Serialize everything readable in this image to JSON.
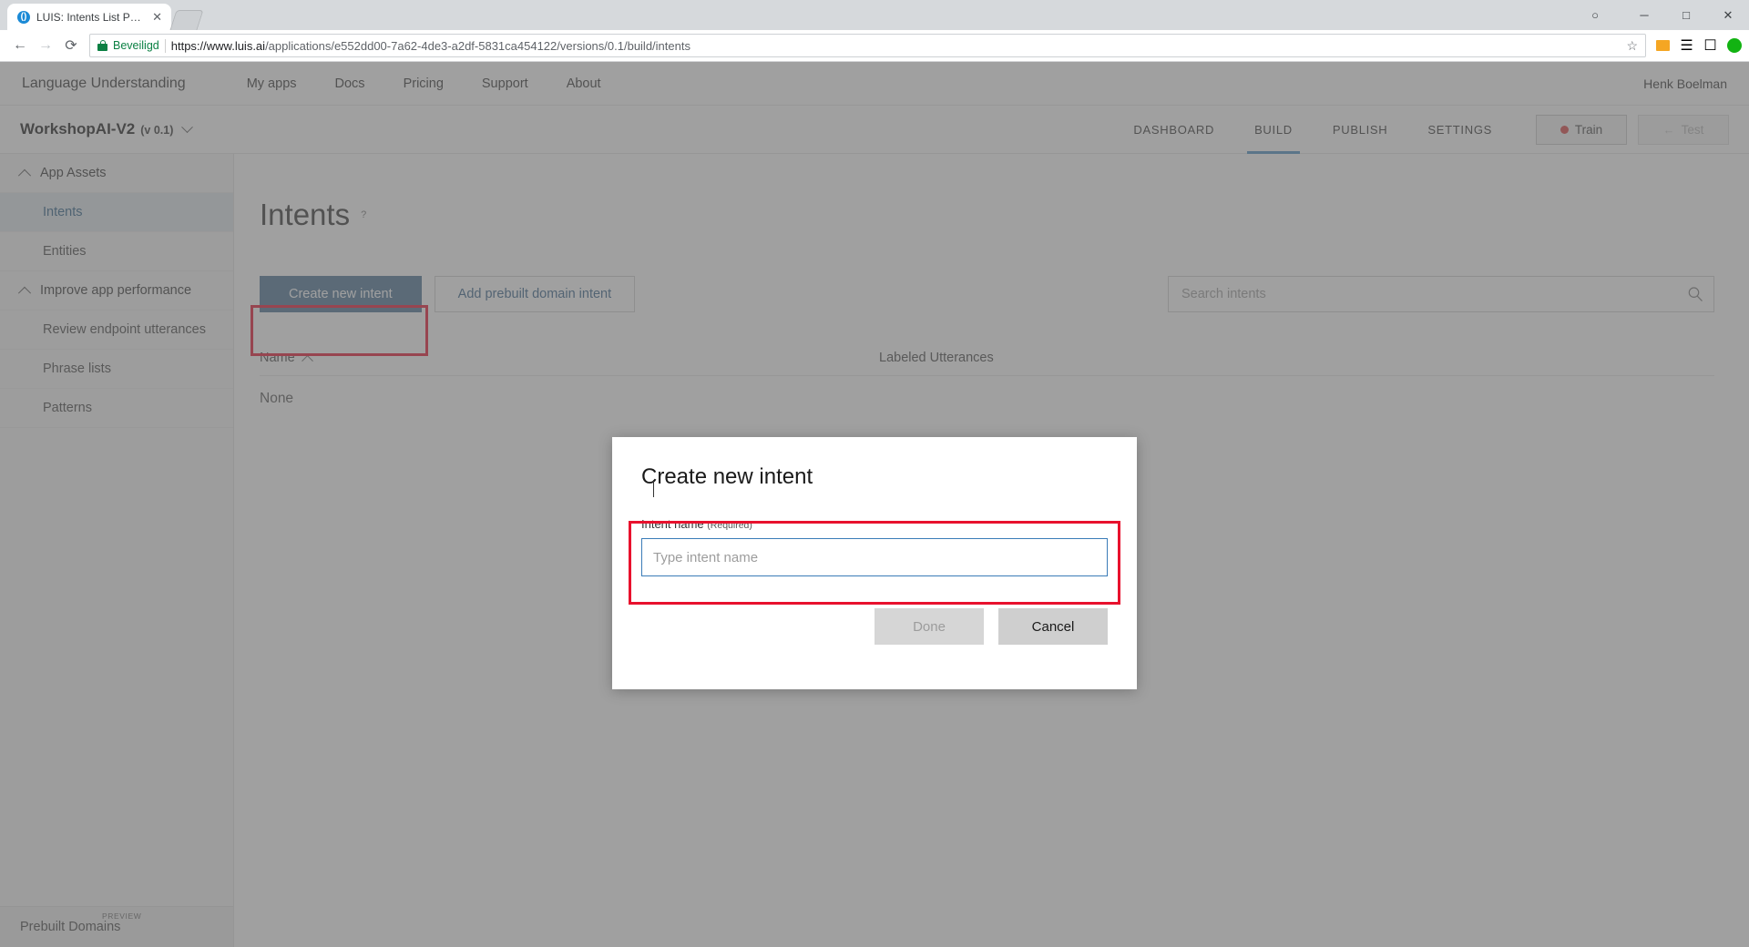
{
  "browser": {
    "tab": {
      "title": "LUIS: Intents List Page",
      "favicon": "luis-icon",
      "close": "✕"
    },
    "new_tab_label": "+",
    "window_controls": {
      "account": "○",
      "minimize": "─",
      "maximize": "□",
      "close": "✕"
    },
    "nav": {
      "back": "←",
      "forward": "→",
      "reload": "⟳"
    },
    "address": {
      "security_label": "Beveiligd",
      "url_host": "https://www.luis.ai",
      "url_path": "/applications/e552dd00-7a62-4de3-a2df-5831ca454122/versions/0.1/build/intents",
      "star": "☆"
    }
  },
  "site_header": {
    "brand": "Language Understanding",
    "nav": [
      {
        "label": "My apps"
      },
      {
        "label": "Docs"
      },
      {
        "label": "Pricing"
      },
      {
        "label": "Support"
      },
      {
        "label": "About"
      }
    ],
    "user": "Henk Boelman"
  },
  "app_bar": {
    "app_name": "WorkshopAI-V2",
    "version": "(v 0.1)",
    "tabs": [
      {
        "label": "DASHBOARD",
        "active": false
      },
      {
        "label": "BUILD",
        "active": true
      },
      {
        "label": "PUBLISH",
        "active": false
      },
      {
        "label": "SETTINGS",
        "active": false
      }
    ],
    "train_label": "Train",
    "test_label": "Test",
    "active_accent": "#4a8ec2"
  },
  "sidebar": {
    "groups": [
      {
        "label": "App Assets"
      },
      {
        "label": "Improve app performance"
      }
    ],
    "items": [
      {
        "label": "Intents",
        "active": true
      },
      {
        "label": "Entities",
        "active": false
      },
      {
        "label": "Review endpoint utterances",
        "active": false
      },
      {
        "label": "Phrase lists",
        "active": false
      },
      {
        "label": "Patterns",
        "active": false
      }
    ],
    "bottom": {
      "label": "Prebuilt Domains",
      "badge": "PREVIEW"
    }
  },
  "main": {
    "page_title": "Intents",
    "help_glyph": "?",
    "create_button": "Create new intent",
    "prebuilt_button": "Add prebuilt domain intent",
    "search_placeholder": "Search intents",
    "search_value": "",
    "table": {
      "columns": [
        "Name",
        "Labeled Utterances"
      ],
      "rows": [],
      "empty_text": "None"
    }
  },
  "modal": {
    "title": "Create new intent",
    "field_label": "Intent name",
    "field_required": "(Required)",
    "input_value": "",
    "input_placeholder": "Type intent name",
    "done_label": "Done",
    "cancel_label": "Cancel"
  },
  "annotation": {
    "color": "#e8112d"
  }
}
